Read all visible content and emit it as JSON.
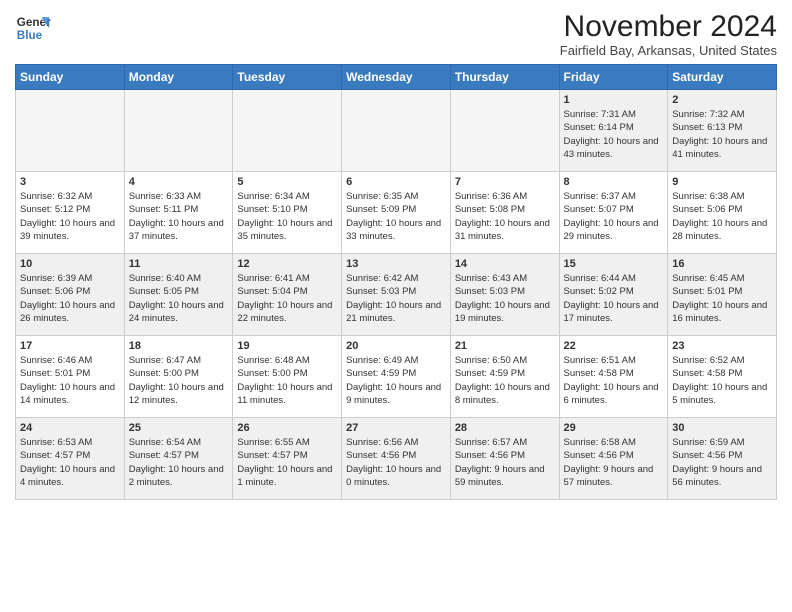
{
  "logo": {
    "line1": "General",
    "line2": "Blue"
  },
  "title": "November 2024",
  "location": "Fairfield Bay, Arkansas, United States",
  "days_of_week": [
    "Sunday",
    "Monday",
    "Tuesday",
    "Wednesday",
    "Thursday",
    "Friday",
    "Saturday"
  ],
  "weeks": [
    [
      {
        "day": "",
        "empty": true
      },
      {
        "day": "",
        "empty": true
      },
      {
        "day": "",
        "empty": true
      },
      {
        "day": "",
        "empty": true
      },
      {
        "day": "",
        "empty": true
      },
      {
        "day": "1",
        "sunrise": "7:31 AM",
        "sunset": "6:14 PM",
        "daylight": "10 hours and 43 minutes."
      },
      {
        "day": "2",
        "sunrise": "7:32 AM",
        "sunset": "6:13 PM",
        "daylight": "10 hours and 41 minutes."
      }
    ],
    [
      {
        "day": "3",
        "sunrise": "6:32 AM",
        "sunset": "5:12 PM",
        "daylight": "10 hours and 39 minutes."
      },
      {
        "day": "4",
        "sunrise": "6:33 AM",
        "sunset": "5:11 PM",
        "daylight": "10 hours and 37 minutes."
      },
      {
        "day": "5",
        "sunrise": "6:34 AM",
        "sunset": "5:10 PM",
        "daylight": "10 hours and 35 minutes."
      },
      {
        "day": "6",
        "sunrise": "6:35 AM",
        "sunset": "5:09 PM",
        "daylight": "10 hours and 33 minutes."
      },
      {
        "day": "7",
        "sunrise": "6:36 AM",
        "sunset": "5:08 PM",
        "daylight": "10 hours and 31 minutes."
      },
      {
        "day": "8",
        "sunrise": "6:37 AM",
        "sunset": "5:07 PM",
        "daylight": "10 hours and 29 minutes."
      },
      {
        "day": "9",
        "sunrise": "6:38 AM",
        "sunset": "5:06 PM",
        "daylight": "10 hours and 28 minutes."
      }
    ],
    [
      {
        "day": "10",
        "sunrise": "6:39 AM",
        "sunset": "5:06 PM",
        "daylight": "10 hours and 26 minutes."
      },
      {
        "day": "11",
        "sunrise": "6:40 AM",
        "sunset": "5:05 PM",
        "daylight": "10 hours and 24 minutes."
      },
      {
        "day": "12",
        "sunrise": "6:41 AM",
        "sunset": "5:04 PM",
        "daylight": "10 hours and 22 minutes."
      },
      {
        "day": "13",
        "sunrise": "6:42 AM",
        "sunset": "5:03 PM",
        "daylight": "10 hours and 21 minutes."
      },
      {
        "day": "14",
        "sunrise": "6:43 AM",
        "sunset": "5:03 PM",
        "daylight": "10 hours and 19 minutes."
      },
      {
        "day": "15",
        "sunrise": "6:44 AM",
        "sunset": "5:02 PM",
        "daylight": "10 hours and 17 minutes."
      },
      {
        "day": "16",
        "sunrise": "6:45 AM",
        "sunset": "5:01 PM",
        "daylight": "10 hours and 16 minutes."
      }
    ],
    [
      {
        "day": "17",
        "sunrise": "6:46 AM",
        "sunset": "5:01 PM",
        "daylight": "10 hours and 14 minutes."
      },
      {
        "day": "18",
        "sunrise": "6:47 AM",
        "sunset": "5:00 PM",
        "daylight": "10 hours and 12 minutes."
      },
      {
        "day": "19",
        "sunrise": "6:48 AM",
        "sunset": "5:00 PM",
        "daylight": "10 hours and 11 minutes."
      },
      {
        "day": "20",
        "sunrise": "6:49 AM",
        "sunset": "4:59 PM",
        "daylight": "10 hours and 9 minutes."
      },
      {
        "day": "21",
        "sunrise": "6:50 AM",
        "sunset": "4:59 PM",
        "daylight": "10 hours and 8 minutes."
      },
      {
        "day": "22",
        "sunrise": "6:51 AM",
        "sunset": "4:58 PM",
        "daylight": "10 hours and 6 minutes."
      },
      {
        "day": "23",
        "sunrise": "6:52 AM",
        "sunset": "4:58 PM",
        "daylight": "10 hours and 5 minutes."
      }
    ],
    [
      {
        "day": "24",
        "sunrise": "6:53 AM",
        "sunset": "4:57 PM",
        "daylight": "10 hours and 4 minutes."
      },
      {
        "day": "25",
        "sunrise": "6:54 AM",
        "sunset": "4:57 PM",
        "daylight": "10 hours and 2 minutes."
      },
      {
        "day": "26",
        "sunrise": "6:55 AM",
        "sunset": "4:57 PM",
        "daylight": "10 hours and 1 minute."
      },
      {
        "day": "27",
        "sunrise": "6:56 AM",
        "sunset": "4:56 PM",
        "daylight": "10 hours and 0 minutes."
      },
      {
        "day": "28",
        "sunrise": "6:57 AM",
        "sunset": "4:56 PM",
        "daylight": "9 hours and 59 minutes."
      },
      {
        "day": "29",
        "sunrise": "6:58 AM",
        "sunset": "4:56 PM",
        "daylight": "9 hours and 57 minutes."
      },
      {
        "day": "30",
        "sunrise": "6:59 AM",
        "sunset": "4:56 PM",
        "daylight": "9 hours and 56 minutes."
      }
    ]
  ]
}
